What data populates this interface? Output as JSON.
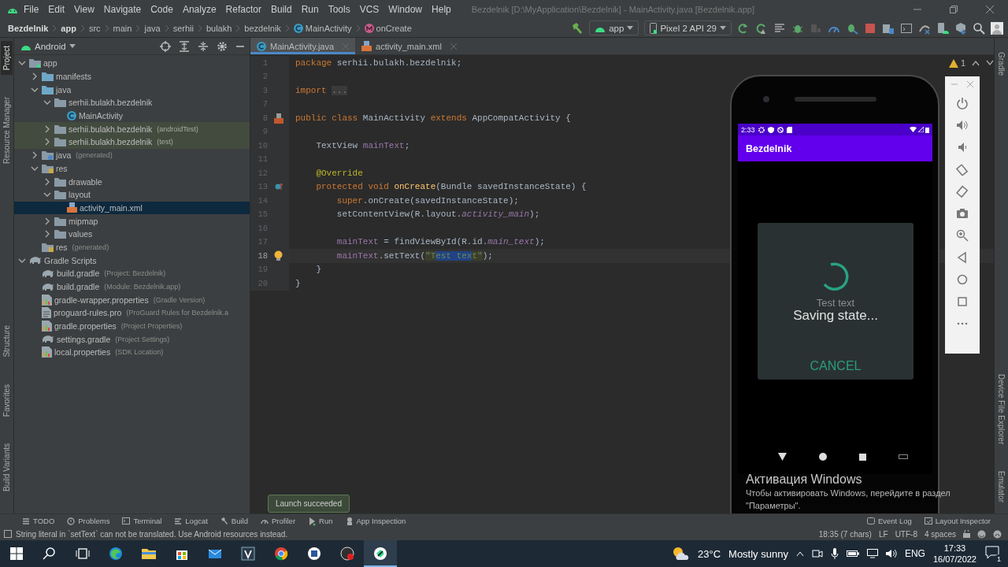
{
  "menu_bar": {
    "items": [
      "File",
      "Edit",
      "View",
      "Navigate",
      "Code",
      "Analyze",
      "Refactor",
      "Build",
      "Run",
      "Tools",
      "VCS",
      "Window",
      "Help"
    ],
    "title": "Bezdelnik [D:\\MyApplication\\Bezdelnik] - MainActivity.java [Bezdelnik.app]"
  },
  "breadcrumbs": [
    {
      "label": "Bezdelnik",
      "kind": "bold"
    },
    {
      "label": "app",
      "kind": "bold"
    },
    {
      "label": "src",
      "kind": "plain"
    },
    {
      "label": "main",
      "kind": "plain"
    },
    {
      "label": "java",
      "kind": "plain"
    },
    {
      "label": "serhii",
      "kind": "plain"
    },
    {
      "label": "bulakh",
      "kind": "plain"
    },
    {
      "label": "bezdelnik",
      "kind": "plain"
    },
    {
      "label": "MainActivity",
      "kind": "class"
    },
    {
      "label": "onCreate",
      "kind": "method"
    }
  ],
  "toolbar": {
    "run_config": "app",
    "device": "Pixel 2 API 29"
  },
  "side_stripes": {
    "left_top": [
      {
        "label": "Project",
        "selected": true
      },
      {
        "label": "Resource Manager",
        "selected": false
      }
    ],
    "left_bottom": [
      {
        "label": "Structure",
        "selected": false
      },
      {
        "label": "Favorites",
        "selected": false
      },
      {
        "label": "Build Variants",
        "selected": false
      }
    ],
    "right_top": [
      {
        "label": "Gradle",
        "selected": false
      }
    ],
    "right_bottom": [
      {
        "label": "Device File Explorer",
        "selected": false
      },
      {
        "label": "Emulator",
        "selected": false
      }
    ]
  },
  "project_panel": {
    "view": "Android",
    "tree": [
      {
        "label": "app",
        "kind": "module",
        "expanded": true,
        "selected": false,
        "children": [
          {
            "label": "manifests",
            "kind": "folder",
            "expanded": false,
            "selected": false
          },
          {
            "label": "java",
            "kind": "folder",
            "expanded": true,
            "selected": false,
            "children": [
              {
                "label": "serhii.bulakh.bezdelnik",
                "kind": "package",
                "expanded": true,
                "selected": false,
                "children": [
                  {
                    "label": "MainActivity",
                    "kind": "class",
                    "selected": false
                  }
                ]
              },
              {
                "label": "serhii.bulakh.bezdelnik",
                "hint": "(androidTest)",
                "kind": "test-package",
                "expanded": false,
                "selected": false
              },
              {
                "label": "serhii.bulakh.bezdelnik",
                "hint": "(test)",
                "kind": "test-package",
                "expanded": false,
                "selected": false
              }
            ]
          },
          {
            "label": "java",
            "hint": "(generated)",
            "kind": "generated",
            "expanded": false,
            "selected": false
          },
          {
            "label": "res",
            "kind": "resources",
            "expanded": true,
            "selected": false,
            "children": [
              {
                "label": "drawable",
                "kind": "package",
                "expanded": false,
                "selected": false
              },
              {
                "label": "layout",
                "kind": "package",
                "expanded": true,
                "selected": false,
                "children": [
                  {
                    "label": "activity_main.xml",
                    "kind": "layout",
                    "selected": true
                  }
                ]
              },
              {
                "label": "mipmap",
                "kind": "package",
                "expanded": false,
                "selected": false
              },
              {
                "label": "values",
                "kind": "package",
                "expanded": false,
                "selected": false
              }
            ]
          },
          {
            "label": "res",
            "hint": "(generated)",
            "kind": "resources",
            "selected": false
          }
        ]
      },
      {
        "label": "Gradle Scripts",
        "kind": "gradle",
        "expanded": true,
        "selected": false,
        "children": [
          {
            "label": "build.gradle",
            "hint": "(Project: Bezdelnik)",
            "kind": "gradle",
            "selected": false
          },
          {
            "label": "build.gradle",
            "hint": "(Module: Bezdelnik.app)",
            "kind": "gradle",
            "selected": false
          },
          {
            "label": "gradle-wrapper.properties",
            "hint": "(Gradle Version)",
            "kind": "properties",
            "selected": false
          },
          {
            "label": "proguard-rules.pro",
            "hint": "(ProGuard Rules for Bezdelnik.a",
            "kind": "file",
            "selected": false
          },
          {
            "label": "gradle.properties",
            "hint": "(Project Properties)",
            "kind": "properties",
            "selected": false
          },
          {
            "label": "settings.gradle",
            "hint": "(Project Settings)",
            "kind": "gradle",
            "selected": false
          },
          {
            "label": "local.properties",
            "hint": "(SDK Location)",
            "kind": "properties",
            "selected": false
          }
        ]
      }
    ]
  },
  "editor": {
    "tabs": [
      {
        "label": "MainActivity.java",
        "kind": "class",
        "selected": true
      },
      {
        "label": "activity_main.xml",
        "kind": "layout",
        "selected": false
      }
    ],
    "inspection": {
      "warnings": "1"
    },
    "lines": [
      {
        "number": "1",
        "current": false,
        "kind": "plain",
        "tokens": [
          {
            "kind": "keyword",
            "text": "package"
          },
          {
            "kind": "plain",
            "text": " serhii.bulakh.bezdelnik;"
          }
        ]
      },
      {
        "number": "2",
        "current": false,
        "kind": "plain"
      },
      {
        "number": "3",
        "current": false,
        "kind": "plain",
        "tokens": [
          {
            "kind": "keyword",
            "text": "import "
          },
          {
            "kind": "folded",
            "text": "..."
          }
        ]
      },
      {
        "number": "7",
        "current": false,
        "kind": "plain"
      },
      {
        "number": "8",
        "current": false,
        "kind": "class",
        "tokens": [
          {
            "kind": "keyword",
            "text": "public class"
          },
          {
            "kind": "plain",
            "text": " MainActivity "
          },
          {
            "kind": "keyword",
            "text": "extends"
          },
          {
            "kind": "plain",
            "text": " AppCompatActivity {"
          }
        ]
      },
      {
        "number": "9",
        "current": false,
        "kind": "plain"
      },
      {
        "number": "10",
        "current": false,
        "kind": "plain",
        "tokens": [
          {
            "kind": "plain",
            "text": "    TextView "
          },
          {
            "kind": "field",
            "text": "mainText"
          },
          {
            "kind": "plain",
            "text": ";"
          }
        ]
      },
      {
        "number": "11",
        "current": false,
        "kind": "plain"
      },
      {
        "number": "12",
        "current": false,
        "kind": "plain",
        "tokens": [
          {
            "kind": "annotation",
            "text": "    @Override"
          }
        ]
      },
      {
        "number": "13",
        "current": false,
        "kind": "override",
        "tokens": [
          {
            "kind": "keyword",
            "text": "    protected void "
          },
          {
            "kind": "method",
            "text": "onCreate"
          },
          {
            "kind": "plain",
            "text": "(Bundle savedInstanceState) {"
          }
        ]
      },
      {
        "number": "14",
        "current": false,
        "kind": "plain",
        "tokens": [
          {
            "kind": "keyword",
            "text": "        super"
          },
          {
            "kind": "plain",
            "text": ".onCreate(savedInstanceState);"
          }
        ]
      },
      {
        "number": "15",
        "current": false,
        "kind": "plain",
        "tokens": [
          {
            "kind": "plain",
            "text": "        setContentView(R.layout."
          },
          {
            "kind": "static",
            "text": "activity_main"
          },
          {
            "kind": "plain",
            "text": ");"
          }
        ]
      },
      {
        "number": "16",
        "current": false,
        "kind": "plain"
      },
      {
        "number": "17",
        "current": false,
        "kind": "plain",
        "tokens": [
          {
            "kind": "field",
            "text": "        mainText"
          },
          {
            "kind": "plain",
            "text": " = findViewById(R.id."
          },
          {
            "kind": "static",
            "text": "main_text"
          },
          {
            "kind": "plain",
            "text": ");"
          }
        ]
      },
      {
        "number": "18",
        "current": true,
        "kind": "bulb",
        "tokens": [
          {
            "kind": "field",
            "text": "        mainText"
          },
          {
            "kind": "plain",
            "text": ".setText("
          },
          {
            "kind": "string",
            "text": "\"T"
          },
          {
            "kind": "selected",
            "text": "est tex"
          },
          {
            "kind": "string",
            "text": "t\""
          },
          {
            "kind": "plain",
            "text": ");"
          }
        ]
      },
      {
        "number": "19",
        "current": false,
        "kind": "plain",
        "tokens": [
          {
            "kind": "plain",
            "text": "    }"
          }
        ]
      },
      {
        "number": "20",
        "current": false,
        "kind": "plain",
        "tokens": [
          {
            "kind": "plain",
            "text": "}"
          }
        ]
      }
    ]
  },
  "emulator": {
    "status_time": "2:33",
    "app_title": "Bezdelnik",
    "dialog": {
      "message": "Test text",
      "title": "Saving state...",
      "button": "CANCEL"
    }
  },
  "notification": "Launch succeeded",
  "activation_notice": {
    "title": "Активация Windows",
    "text": "Чтобы активировать Windows, перейдите в раздел \"Параметры\"."
  },
  "tool_windows": {
    "left": [
      {
        "label": "TODO",
        "kind": "todo"
      },
      {
        "label": "Problems",
        "kind": "problems"
      },
      {
        "label": "Terminal",
        "kind": "terminal"
      },
      {
        "label": "Logcat",
        "kind": "logcat"
      },
      {
        "label": "Build",
        "kind": "build"
      },
      {
        "label": "Profiler",
        "kind": "profiler"
      },
      {
        "label": "Run",
        "kind": "run"
      },
      {
        "label": "App Inspection",
        "kind": "inspection"
      }
    ],
    "right": [
      {
        "label": "Event Log",
        "kind": "event-log"
      },
      {
        "label": "Layout Inspector",
        "kind": "layout-inspector"
      }
    ]
  },
  "status_bar": {
    "message": "String literal in `setText` can not be translated. Use Android resources instead.",
    "position": "18:35 (7 chars)",
    "line_separator": "LF",
    "encoding": "UTF-8",
    "indent": "4 spaces"
  },
  "taskbar": {
    "weather": {
      "temperature": "23°C",
      "condition": "Mostly sunny"
    },
    "language": "ENG",
    "time": "17:33",
    "date": "16/07/2022",
    "notifications": "1"
  }
}
